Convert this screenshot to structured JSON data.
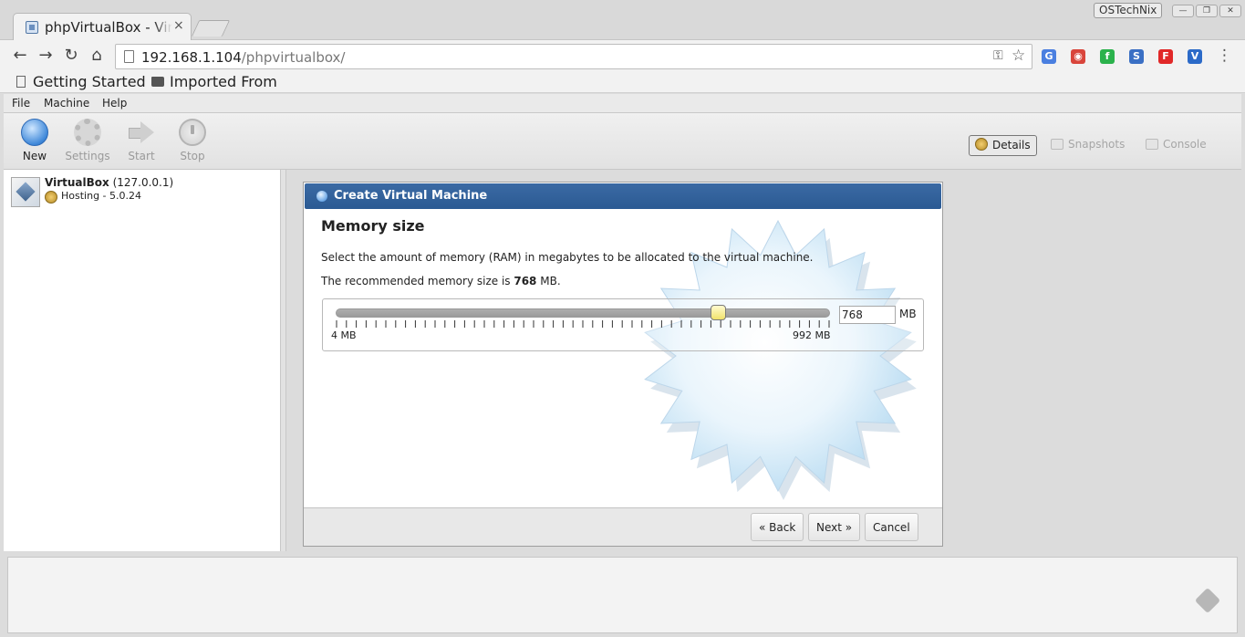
{
  "browser": {
    "tab_title": "phpVirtualBox - VirtualBox Web Console",
    "tab_close": "×",
    "profile_name": "OSTechNix",
    "win_min": "—",
    "win_restore": "❐",
    "win_close": "✕",
    "nav": {
      "back": "←",
      "forward": "→",
      "reload": "↻",
      "home": "⌂"
    },
    "url_host": "192.168.1.104",
    "url_path": "/phpvirtualbox/",
    "key_glyph": "⚿",
    "star_glyph": "☆",
    "menu_glyph": "⋮",
    "extensions": [
      {
        "name": "google-translate-icon",
        "glyph": "G",
        "color": "#4a7fe0"
      },
      {
        "name": "chrome-extension-icon",
        "glyph": "◉",
        "color": "#d9453b"
      },
      {
        "name": "feedly-extension-icon",
        "glyph": "f",
        "color": "#2bb24c"
      },
      {
        "name": "simplenote-icon",
        "glyph": "S",
        "color": "#3a6fc4"
      },
      {
        "name": "flipboard-icon",
        "glyph": "F",
        "color": "#e12828"
      },
      {
        "name": "vivaldi-extension-icon",
        "glyph": "V",
        "color": "#2b6ac8"
      }
    ],
    "bookmarks": [
      {
        "label": "Getting Started"
      },
      {
        "label": "Imported From"
      }
    ]
  },
  "app": {
    "menu": [
      "File",
      "Machine",
      "Help"
    ],
    "toolbar": {
      "new": "New",
      "settings": "Settings",
      "start": "Start",
      "stop": "Stop"
    },
    "views": {
      "details": "Details",
      "snapshots": "Snapshots",
      "console": "Console"
    },
    "host": {
      "name": "VirtualBox",
      "address": "(127.0.0.1)",
      "status": "Hosting - 5.0.24"
    }
  },
  "wizard": {
    "title": "Create Virtual Machine",
    "heading": "Memory size",
    "description": "Select the amount of memory (RAM) in megabytes to be allocated to the virtual machine.",
    "recommended_prefix": "The recommended memory size is ",
    "recommended_value": "768",
    "recommended_suffix": " MB.",
    "memory_value": "768",
    "memory_unit": "MB",
    "slider": {
      "min": 4,
      "max": 992,
      "value": 768,
      "min_label": "4 MB",
      "max_label": "992 MB",
      "tick_count": 50
    },
    "buttons": {
      "back": "« Back",
      "next": "Next »",
      "cancel": "Cancel"
    }
  }
}
